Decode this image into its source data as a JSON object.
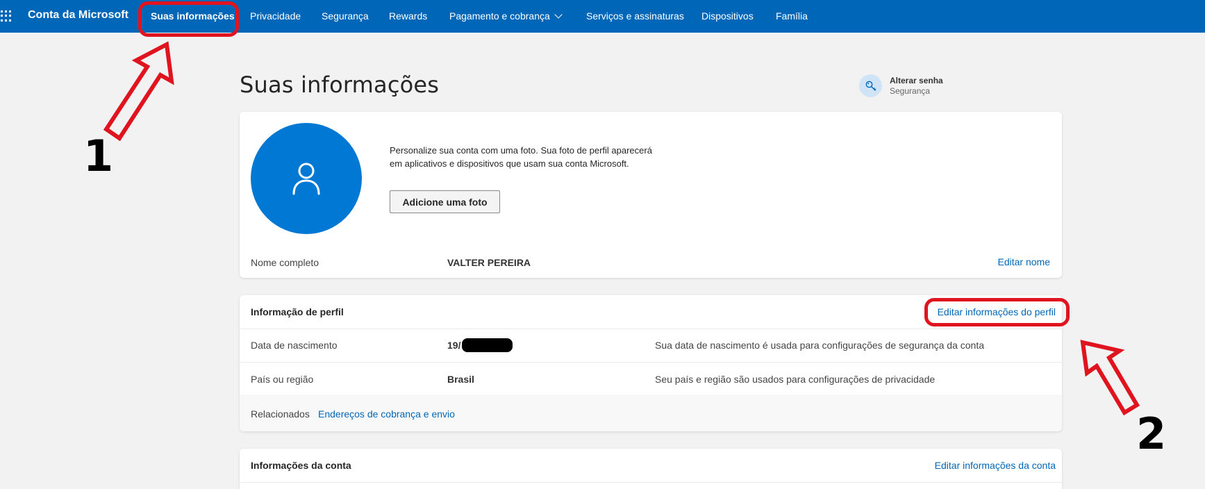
{
  "nav": {
    "brand": "Conta da Microsoft",
    "items": [
      {
        "label": "Suas informações"
      },
      {
        "label": "Privacidade"
      },
      {
        "label": "Segurança"
      },
      {
        "label": "Rewards"
      },
      {
        "label": "Pagamento e cobrança"
      },
      {
        "label": "Serviços e assinaturas"
      },
      {
        "label": "Dispositivos"
      },
      {
        "label": "Família"
      }
    ]
  },
  "page": {
    "title": "Suas informações",
    "quick_link": {
      "title": "Alterar senha",
      "subtitle": "Segurança",
      "icon": "key-icon"
    }
  },
  "photo_card": {
    "text": "Personalize sua conta com uma foto. Sua foto de perfil aparecerá em aplicativos e dispositivos que usam sua conta Microsoft.",
    "button": "Adicione uma foto",
    "name_label": "Nome completo",
    "name_value": "VALTER PEREIRA",
    "edit_link": "Editar nome"
  },
  "profile_card": {
    "title": "Informação de perfil",
    "edit_link": "Editar informações do perfil",
    "rows": [
      {
        "label": "Data de nascimento",
        "value": "19/",
        "description": "Sua data de nascimento é usada para configurações de segurança da conta"
      },
      {
        "label": "País ou região",
        "value": "Brasil",
        "description": "Seu país e região são usados para configurações de privacidade"
      }
    ],
    "related_label": "Relacionados",
    "related_link": "Endereços de cobrança e envio"
  },
  "account_card": {
    "title": "Informações da conta",
    "edit_link": "Editar informações da conta"
  },
  "annotations": {
    "one": "1",
    "two": "2",
    "color": "#e0141e"
  },
  "colors": {
    "nav_bg": "#0067b8",
    "avatar": "#0078d4",
    "link": "#0067b8"
  }
}
